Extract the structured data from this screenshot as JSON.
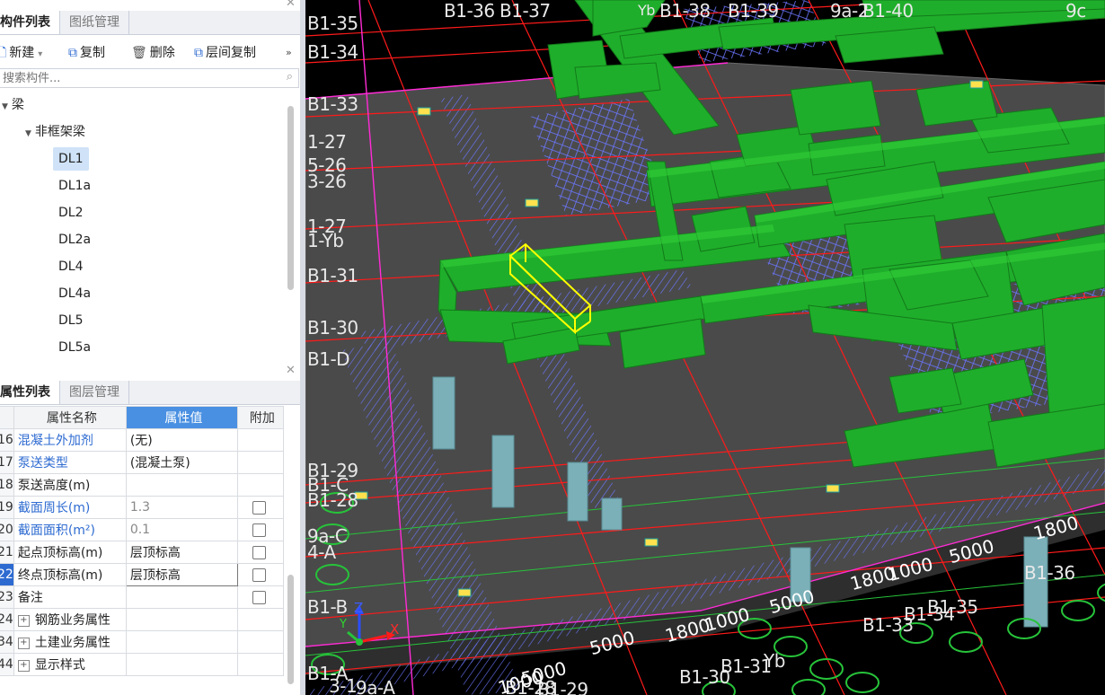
{
  "component_panel": {
    "tabs": [
      "构件列表",
      "图纸管理"
    ],
    "toolbar": {
      "new": "新建",
      "copy": "复制",
      "delete": "删除",
      "floor_copy": "层间复制"
    },
    "search_placeholder": "搜索构件...",
    "tree": {
      "root": "梁",
      "group": "非框架梁",
      "items": [
        "DL1",
        "DL1a",
        "DL2",
        "DL2a",
        "DL4",
        "DL4a",
        "DL5",
        "DL5a"
      ],
      "selected": "DL1"
    }
  },
  "property_panel": {
    "tabs": [
      "属性列表",
      "图层管理"
    ],
    "columns": [
      "属性名称",
      "属性值",
      "附加"
    ],
    "rows": [
      {
        "num": "16",
        "name": "混凝土外加剂",
        "value": "(无)",
        "has_check": false
      },
      {
        "num": "17",
        "name": "泵送类型",
        "value": "(混凝土泵)",
        "has_check": false
      },
      {
        "num": "18",
        "name": "泵送高度(m)",
        "value": "",
        "has_check": false
      },
      {
        "num": "19",
        "name": "截面周长(m)",
        "value": "1.3",
        "has_check": true
      },
      {
        "num": "20",
        "name": "截面面积(m²)",
        "value": "0.1",
        "has_check": true
      },
      {
        "num": "21",
        "name": "起点顶标高(m)",
        "value": "层顶标高",
        "has_check": true
      },
      {
        "num": "22",
        "name": "终点顶标高(m)",
        "value": "层顶标高",
        "has_check": true
      },
      {
        "num": "23",
        "name": "备注",
        "value": "",
        "has_check": true
      },
      {
        "num": "24",
        "name": "钢筋业务属性",
        "value": "",
        "has_check": false
      },
      {
        "num": "34",
        "name": "土建业务属性",
        "value": "",
        "has_check": false
      },
      {
        "num": "44",
        "name": "显示样式",
        "value": "",
        "has_check": false
      }
    ]
  },
  "viewport": {
    "axis_labels": [
      "B1-35",
      "B1-34",
      "B1-33",
      "1-27",
      "5-26",
      "3-26",
      "1-27",
      "1-Yb",
      "B1-31",
      "B1-30",
      "B1-D",
      "B1-29",
      "B1-C",
      "B1-28",
      "9a-C",
      "4-A",
      "B1-B",
      "B1-A",
      "3-1",
      "9a-A",
      "B1-36",
      "B1-37",
      "Yb",
      "B1-38",
      "B1-39",
      "9a-2",
      "B1-40",
      "9c",
      "B1-33",
      "B1-34",
      "B1-35",
      "B1-36",
      "B1-31",
      "B1-30",
      "Yb",
      "B1-28",
      "B1-29"
    ],
    "dimension_labels": [
      "5000",
      "1800",
      "1000",
      "5000",
      "1800",
      "5000",
      "1800",
      "1000",
      "5000",
      "1000",
      "1800"
    ],
    "triad": {
      "x": "X",
      "y": "Y",
      "z": "Z"
    },
    "colors": {
      "beam": "#1fae2b",
      "beam_light": "#33d43a",
      "selected": "#ffff00",
      "slab": "#505050",
      "axis_red": "#ff1a1a",
      "axis_magenta": "#ff2bd6",
      "hatch_blue": "#6b77ff",
      "column": "#7bb0b8"
    }
  }
}
